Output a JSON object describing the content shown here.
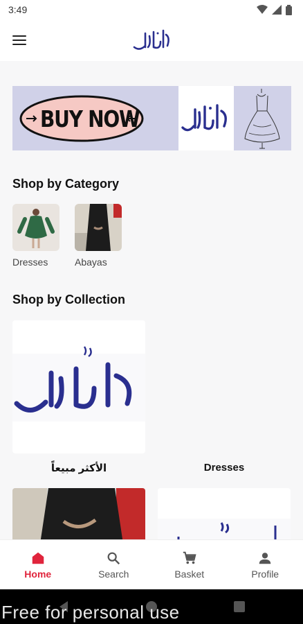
{
  "status": {
    "time": "3:49"
  },
  "banner": {
    "cta_label": "BUY NOW"
  },
  "categories": {
    "title": "Shop by Category",
    "items": [
      {
        "label": "Dresses"
      },
      {
        "label": "Abayas"
      }
    ]
  },
  "collections": {
    "title": "Shop by Collection",
    "items": [
      {
        "label": "الأكثر مبيعاً"
      },
      {
        "label": "Dresses"
      }
    ]
  },
  "nav": {
    "items": [
      {
        "label": "Home",
        "icon": "home-icon",
        "active": true
      },
      {
        "label": "Search",
        "icon": "search-icon",
        "active": false
      },
      {
        "label": "Basket",
        "icon": "cart-icon",
        "active": false
      },
      {
        "label": "Profile",
        "icon": "person-icon",
        "active": false
      }
    ]
  },
  "watermark": "Free for personal use",
  "colors": {
    "accent": "#e0243c",
    "brand_blue": "#2a2f8f",
    "banner_bg": "#d0d1e8",
    "cta_pink": "#f6c9c4"
  }
}
